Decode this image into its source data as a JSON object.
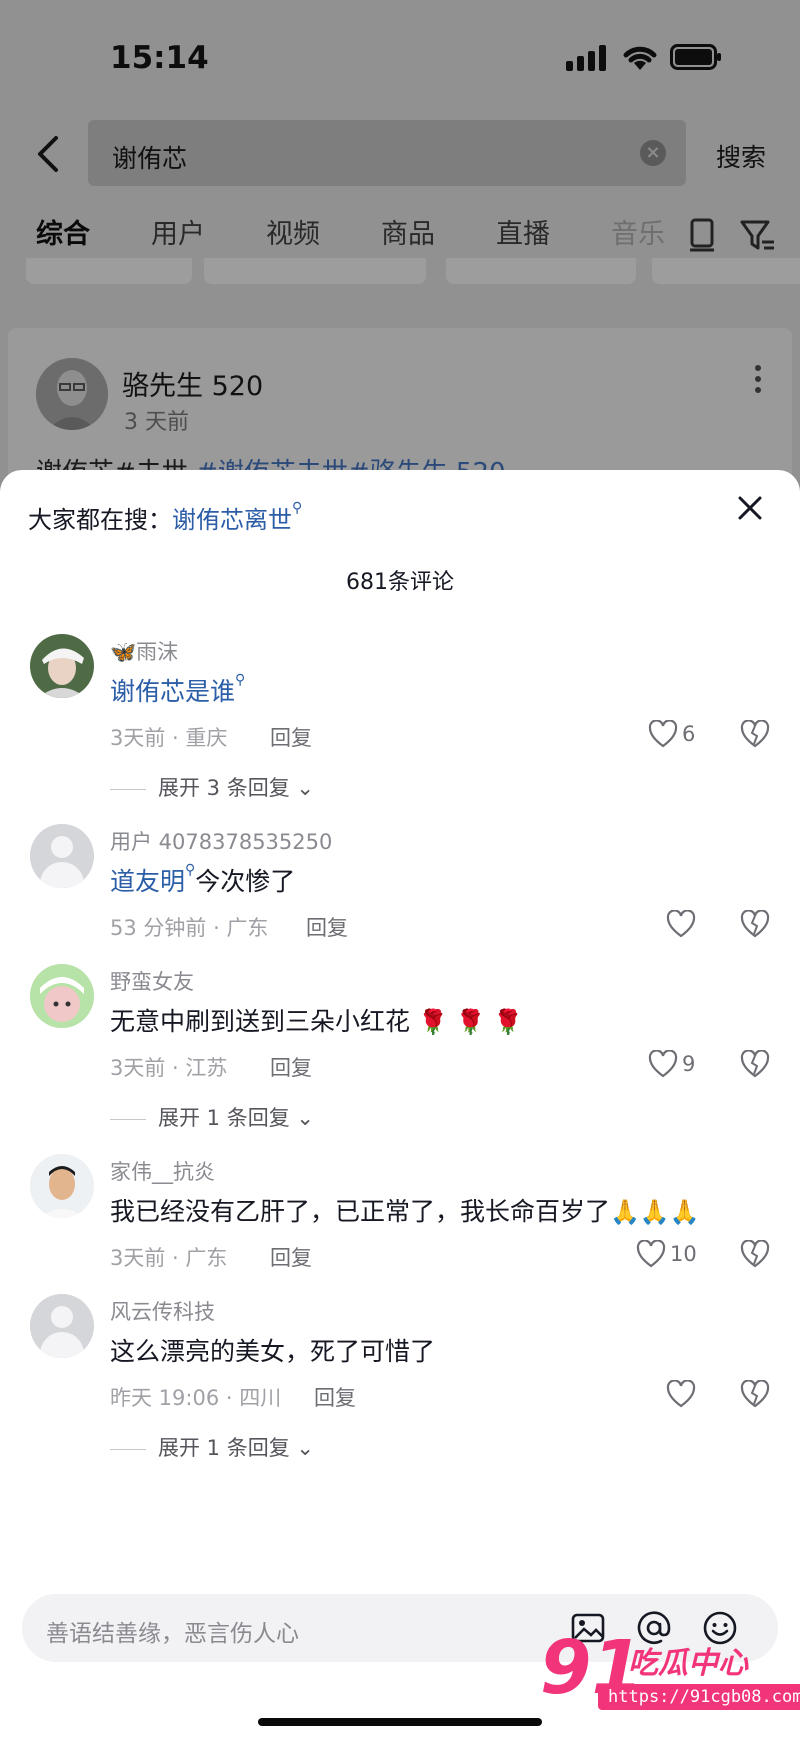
{
  "status_bar": {
    "time": "15:14"
  },
  "search": {
    "query": "谢侑芯",
    "submit_label": "搜索"
  },
  "tabs": [
    {
      "label": "综合"
    },
    {
      "label": "用户"
    },
    {
      "label": "视频"
    },
    {
      "label": "商品"
    },
    {
      "label": "直播"
    },
    {
      "label": "音乐"
    }
  ],
  "post": {
    "author": "骆先生 520",
    "time": "3 天前",
    "text_plain": "谢侑芯#去世",
    "text_tags": "#谢侑芯去世#骆先生 520"
  },
  "sheet": {
    "hot_prefix": "大家都在搜：",
    "hot_keyword": "谢侑芯离世",
    "comment_count": "681条评论"
  },
  "comments": [
    {
      "name": "雨沫",
      "text_link": "谢侑芯是谁",
      "text": "",
      "time": "3天前",
      "location": "重庆",
      "reply": "回复",
      "likes": "6",
      "expand": "展开 3 条回复"
    },
    {
      "name": "用户 4078378535250",
      "text_link": "道友明",
      "text": "今次惨了",
      "time": "53 分钟前",
      "location": "广东",
      "reply": "回复",
      "likes": "",
      "expand": ""
    },
    {
      "name": "野蛮女友",
      "text_link": "",
      "text": "无意中刷到送到三朵小红花",
      "emoji": "🌹 🌹 🌹",
      "time": "3天前",
      "location": "江苏",
      "reply": "回复",
      "likes": "9",
      "expand": "展开 1 条回复"
    },
    {
      "name": "家伟__抗炎",
      "text_link": "",
      "text": "我已经没有乙肝了，已正常了，我长命百岁了",
      "emoji": "🙏🙏🙏",
      "time": "3天前",
      "location": "广东",
      "reply": "回复",
      "likes": "10",
      "expand": ""
    },
    {
      "name": "风云传科技",
      "text_link": "",
      "text": "这么漂亮的美女，死了可惜了",
      "time": "昨天 19:06",
      "location": "四川",
      "reply": "回复",
      "likes": "",
      "expand": "展开 1 条回复"
    }
  ],
  "input": {
    "placeholder": "善语结善缘，恶言伤人心"
  },
  "watermark": {
    "number": "91",
    "text": "吃瓜中心",
    "url": "https://91cgb08.com"
  },
  "colors": {
    "link": "#2c5ea8",
    "accent_watermark": "#f2357a"
  },
  "icons": [
    "back-arrow-icon",
    "clear-icon",
    "filter-icon",
    "close-icon",
    "heart-icon",
    "broken-heart-icon",
    "image-icon",
    "at-icon",
    "emoji-icon"
  ]
}
